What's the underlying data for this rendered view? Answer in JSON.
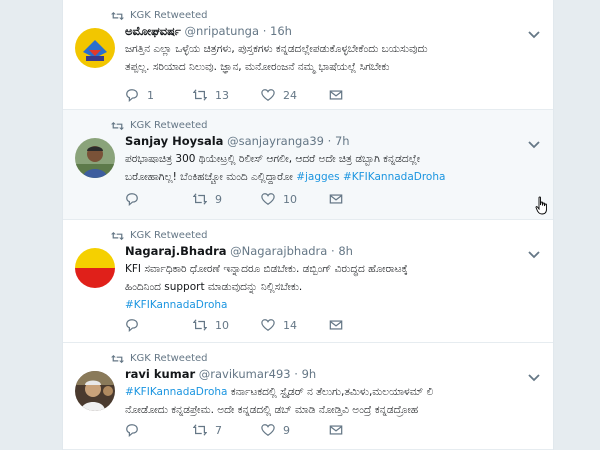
{
  "retweet_label": "KGK Retweeted",
  "tweets": [
    {
      "name": "ಅಮೋಘವರ್ಷ",
      "handle": "@nripatunga",
      "time": "16h",
      "text1": "ಜಗತ್ತಿನ ಎಲ್ಲಾ ಒಳ್ಳೆಯ ಚಿತ್ರಗಳು, ಪುಸ್ತಕಗಳು ಕನ್ನಡದಲ್ಲೇಪಡುಕೊಳ್ಳಬೇಕೆಂದು ಬಯಸುವುದು",
      "text2": "ತಪ್ಪಲ್ಲ. ಸರಿಯಾದ ನಿಲುವು. ಜ್ಞಾನ, ಮನೋರಂಜನೆ ನಮ್ಮ ಭಾಷೆಯಲ್ಲೆ ಸಿಗಬೇಕು",
      "reply": "1",
      "retweet": "13",
      "like": "24"
    },
    {
      "name": "Sanjay Hoysala",
      "handle": "@sanjayranga39",
      "time": "7h",
      "text1": "ಪರಭಾಷಾಚಿತ್ರ 300 ಥಿಯೇಟ್ರಲ್ಲಿ ರಿಲೀಸ್ ಆಗಲೀ, ಆದರೆ ಅದೇ ಚಿತ್ರ ಡಬ್ಬಾಗಿ ಕನ್ನಡದಲ್ಲೇ",
      "text2": "ಬರೋಹಾಗಿಲ್ಲ! ಬೆಂಕಿಹಚ್ಚೋ ಮಂದಿ ಎಲ್ಲಿದ್ದಾರೋ",
      "tag1": "#jagges",
      "tag2": "#KFIKannadaDroha",
      "reply": "",
      "retweet": "9",
      "like": "10"
    },
    {
      "name": "Nagaraj.Bhadra",
      "handle": "@Nagarajbhadra",
      "time": "8h",
      "text1": "KFI ಸರ್ವಾಧಿಕಾರಿ ಧೋರಣೆ ಇನ್ನಾದರೂ ಬಿಡಬೇಕು. ಡಬ್ಬಿಂಗ್ ವಿರುದ್ಧದ ಹೋರಾಟಕ್ಕೆ",
      "text2": "ಹಿಂದಿನಿಂದ support ಮಾಡುವುದನ್ನು ನಿಲ್ಲಿಸಬೇಕು.",
      "tag1": "#KFIKannadaDroha",
      "reply": "",
      "retweet": "10",
      "like": "14"
    },
    {
      "name": "ravi kumar",
      "handle": "@ravikumar493",
      "time": "9h",
      "tag1": "#KFIKannadaDroha",
      "text1": "ಕರ್ನಾಟಕದಲ್ಲಿ ಸ್ಟೈಡರ್ ನ ತೆಲುಗು,ತಮಿಳು,ಮಲಯಾಳಮ್ ಲಿ",
      "text2": "ನೋಡೋದು ಕನ್ನಡಪ್ರೇಮ. ಅದೇ ಕನ್ನಡದಲ್ಲಿ ಡಬ್ ಮಾಡಿ ನೋಡ್ತಿವಿ ಅಂದ್ರೆ ಕನ್ನಡದ್ರೋಹ",
      "reply": "",
      "retweet": "7",
      "like": "9"
    }
  ],
  "colors": {
    "hashtag": "#1b95e0",
    "muted": "#657786",
    "hover_bg": "#f5f8fa"
  }
}
